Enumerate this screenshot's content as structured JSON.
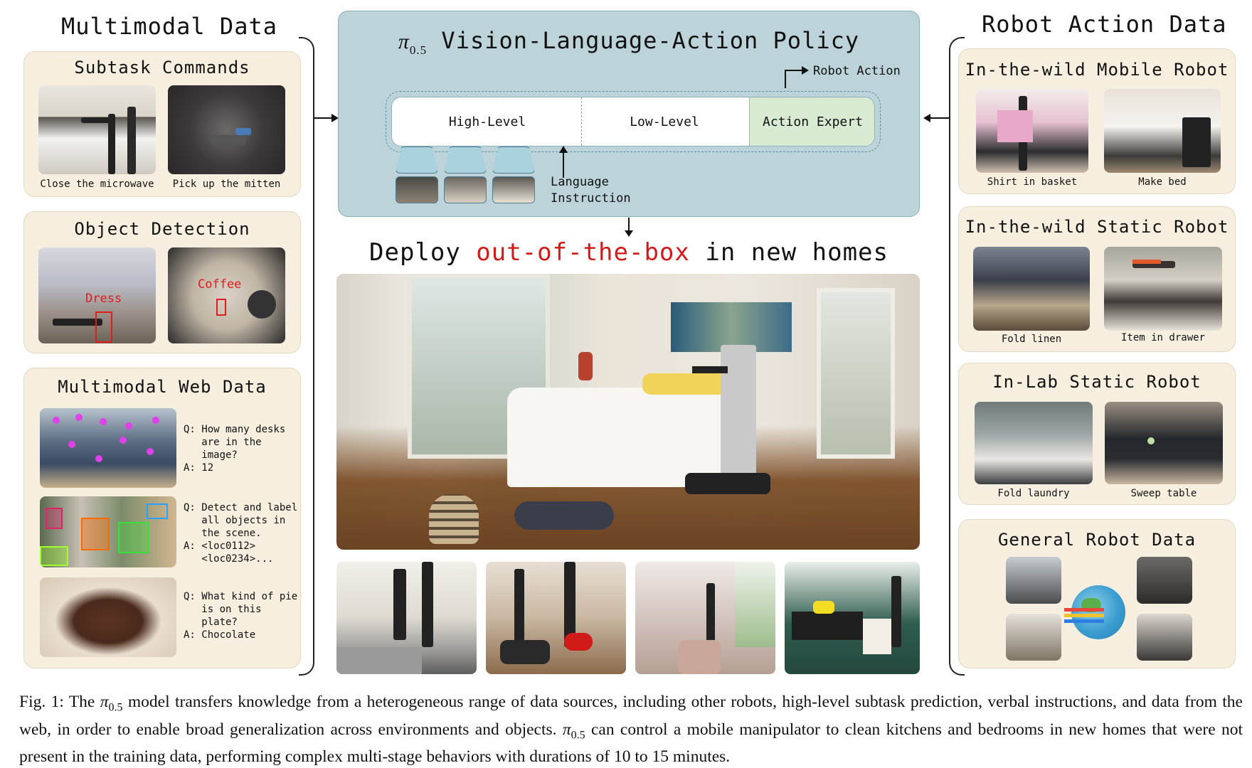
{
  "left": {
    "title": "Multimodal Data",
    "subtask": {
      "title": "Subtask Commands",
      "captions": [
        "Close the microwave",
        "Pick up the mitten"
      ]
    },
    "detection": {
      "title": "Object Detection",
      "labels": [
        "Dress",
        "Coffee"
      ]
    },
    "web": {
      "title": "Multimodal Web Data",
      "qa": [
        "Q: How many desks\n   are in the\n   image?\nA: 12",
        "Q: Detect and label\n   all objects in\n   the scene.\nA: <loc0112>\n   <loc0234>...",
        "Q: What kind of pie\n   is on this\n   plate?\nA: Chocolate"
      ]
    }
  },
  "center": {
    "policy_title_symbol": "π",
    "policy_title_sub": "0.5",
    "policy_title_text": "Vision-Language-Action Policy",
    "robot_action": "Robot Action",
    "segments": [
      "High-Level",
      "Low-Level",
      "Action Expert"
    ],
    "language_instruction": "Language\nInstruction",
    "deploy_pre": "Deploy ",
    "deploy_red": "out-of-the-box",
    "deploy_post": " in new homes"
  },
  "right": {
    "title": "Robot Action Data",
    "mobile": {
      "title": "In-the-wild Mobile Robot",
      "captions": [
        "Shirt in basket",
        "Make bed"
      ]
    },
    "static": {
      "title": "In-the-wild Static Robot",
      "captions": [
        "Fold linen",
        "Item in drawer"
      ]
    },
    "lab": {
      "title": "In-Lab Static Robot",
      "captions": [
        "Fold laundry",
        "Sweep table"
      ]
    },
    "general": {
      "title": "General Robot Data"
    }
  },
  "caption": {
    "lead": "Fig. 1: The ",
    "sym": "π",
    "sub": "0.5",
    "mid": " model transfers knowledge from a heterogeneous range of data sources, including other robots, high-level subtask prediction, verbal instructions, and data from the web, in order to enable broad generalization across environments and objects. ",
    "sym2": "π",
    "sub2": "0.5",
    "tail": " can control a mobile manipulator to clean kitchens and bedrooms in new homes that were not present in the training data, performing complex multi-stage behaviors with durations of 10 to 15 minutes."
  },
  "colors": {
    "panel_bg": "#f6efdf",
    "policy_bg": "#bcd3d9",
    "action_expert_bg": "#d8ead2",
    "highlight_red": "#d11a1a"
  }
}
